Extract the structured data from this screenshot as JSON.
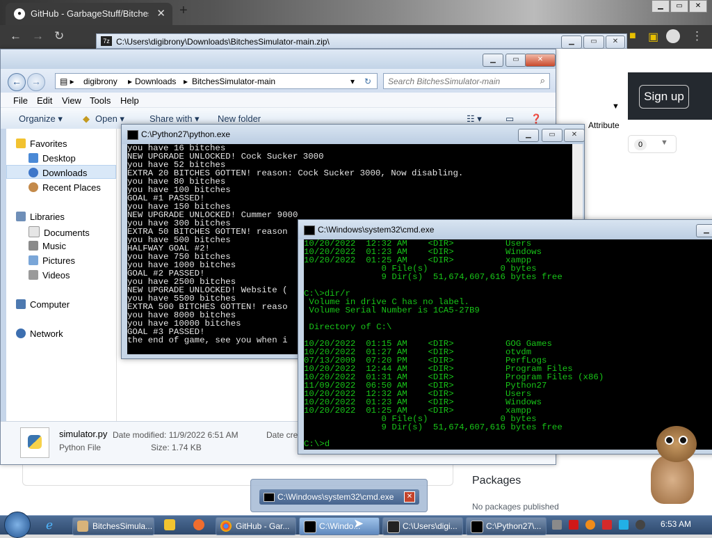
{
  "chrome": {
    "tab_title": "GitHub - GarbageStuff/BitchesSi",
    "tab_close": "✕",
    "new_tab": "+",
    "sign_up": "Sign up",
    "attr_label": "Attribute",
    "count": "0",
    "packages_heading": "Packages",
    "packages_none": "No packages published"
  },
  "explorer": {
    "window_title": "C:\\Users\\digibrony\\Downloads\\BitchesSimulator-main.zip\\",
    "breadcrumb": [
      "digibrony",
      "Downloads",
      "BitchesSimulator-main"
    ],
    "search_placeholder": "Search BitchesSimulator-main",
    "menu": [
      "File",
      "Edit",
      "View",
      "Tools",
      "Help"
    ],
    "commands": {
      "organize": "Organize ▾",
      "open": "Open ▾",
      "share": "Share with ▾",
      "new_folder": "New folder"
    },
    "sidebar": {
      "favorites": "Favorites",
      "desktop": "Desktop",
      "downloads": "Downloads",
      "recent": "Recent Places",
      "libraries": "Libraries",
      "documents": "Documents",
      "music": "Music",
      "pictures": "Pictures",
      "videos": "Videos",
      "computer": "Computer",
      "network": "Network"
    },
    "details": {
      "filename": "simulator.py",
      "filetype": "Python File",
      "date_modified": "Date modified: 11/9/2022 6:51 AM",
      "size": "Size: 1.74 KB",
      "date_created": "Date crea"
    }
  },
  "python_console": {
    "title": "C:\\Python27\\python.exe",
    "lines": [
      "you have 16 bitches",
      "NEW UPGRADE UNLOCKED! Cock Sucker 3000",
      "you have 52 bitches",
      "EXTRA 20 BITCHES GOTTEN! reason: Cock Sucker 3000, Now disabling.",
      "you have 80 bitches",
      "you have 100 bitches",
      "GOAL #1 PASSED!",
      "you have 150 bitches",
      "NEW UPGRADE UNLOCKED! Cummer 9000",
      "you have 300 bitches",
      "EXTRA 50 BITCHES GOTTEN! reason",
      "you have 500 bitches",
      "HALFWAY GOAL #2!",
      "you have 750 bitches",
      "you have 1000 bitches",
      "GOAL #2 PASSED!",
      "you have 2500 bitches",
      "NEW UPGRADE UNLOCKED! Website (",
      "you have 5500 bitches",
      "EXTRA 500 BITCHES GOTTEN! reaso",
      "you have 8000 bitches",
      "you have 10000 bitches",
      "GOAL #3 PASSED!",
      "the end of game, see you when i"
    ]
  },
  "cmd_console": {
    "title": "C:\\Windows\\system32\\cmd.exe",
    "lines": [
      "10/20/2022  12:32 AM    <DIR>          Users",
      "10/20/2022  01:23 AM    <DIR>          Windows",
      "10/20/2022  01:25 AM    <DIR>          xampp",
      "               0 File(s)              0 bytes",
      "               9 Dir(s)  51,674,607,616 bytes free",
      "",
      "C:\\>dir/r",
      " Volume in drive C has no label.",
      " Volume Serial Number is 1CA5-27B9",
      "",
      " Directory of C:\\",
      "",
      "10/20/2022  01:15 AM    <DIR>          GOG Games",
      "10/20/2022  01:27 AM    <DIR>          otvdm",
      "07/13/2009  07:20 PM    <DIR>          PerfLogs",
      "10/20/2022  12:44 AM    <DIR>          Program Files",
      "10/20/2022  01:31 AM    <DIR>          Program Files (x86)",
      "11/09/2022  06:50 AM    <DIR>          Python27",
      "10/20/2022  12:32 AM    <DIR>          Users",
      "10/20/2022  01:23 AM    <DIR>          Windows",
      "10/20/2022  01:25 AM    <DIR>          xampp",
      "               0 File(s)              0 bytes",
      "               9 Dir(s)  51,674,607,616 bytes free",
      "",
      "C:\\>d"
    ]
  },
  "taskbar": {
    "items": [
      "BitchesSimula...",
      "GitHub - Gar...",
      "C:\\Windo...",
      "C:\\Users\\digi...",
      "C:\\Python27\\..."
    ],
    "thumbnail_label": "C:\\Windows\\system32\\cmd.exe",
    "clock": "6:53 AM"
  }
}
